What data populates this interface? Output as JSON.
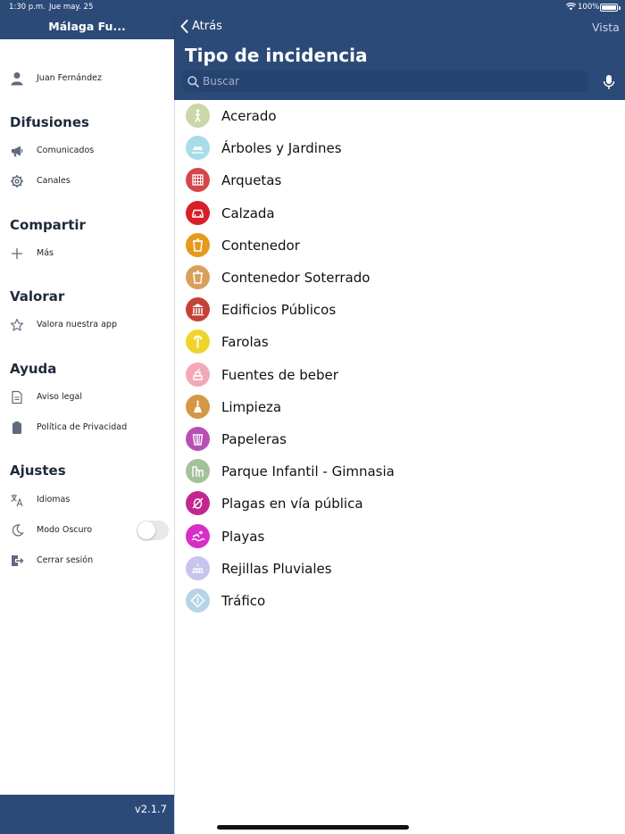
{
  "status": {
    "time": "1:30 p.m.",
    "date": "Jue may. 25",
    "battery": "100%"
  },
  "sidebar": {
    "title": "Málaga Fu...",
    "user": "Juan Fernández",
    "sections": {
      "difusiones": "Difusiones",
      "compartir": "Compartir",
      "valorar": "Valorar",
      "ayuda": "Ayuda",
      "ajustes": "Ajustes"
    },
    "items": {
      "comunicados": "Comunicados",
      "canales": "Canales",
      "mas": "Más",
      "valora": "Valora nuestra app",
      "aviso": "Aviso legal",
      "privacidad": "Política de Privacidad",
      "idiomas": "Idiomas",
      "modo_oscuro": "Modo Oscuro",
      "cerrar": "Cerrar sesión"
    },
    "dark_mode_on": false,
    "version": "v2.1.7"
  },
  "header": {
    "back": "Atrás",
    "vista": "Vista",
    "title": "Tipo de incidencia",
    "search_placeholder": "Buscar"
  },
  "incidencias": [
    {
      "label": "Acerado",
      "color": "#c9d7a9",
      "icon": "pedestrian-icon"
    },
    {
      "label": "Árboles y Jardines",
      "color": "#a9dce9",
      "icon": "tree-icon"
    },
    {
      "label": "Arquetas",
      "color": "#d5464a",
      "icon": "grate-icon"
    },
    {
      "label": "Calzada",
      "color": "#d81f28",
      "icon": "car-icon"
    },
    {
      "label": "Contenedor",
      "color": "#e59a1b",
      "icon": "bin-icon"
    },
    {
      "label": "Contenedor Soterrado",
      "color": "#d9a05c",
      "icon": "bin-icon"
    },
    {
      "label": "Edificios Públicos",
      "color": "#c4423a",
      "icon": "building-icon"
    },
    {
      "label": "Farolas",
      "color": "#efd52b",
      "icon": "lamp-icon"
    },
    {
      "label": "Fuentes de beber",
      "color": "#f1a9b7",
      "icon": "fountain-icon"
    },
    {
      "label": "Limpieza",
      "color": "#d59746",
      "icon": "broom-icon"
    },
    {
      "label": "Papeleras",
      "color": "#b84fb5",
      "icon": "basket-icon"
    },
    {
      "label": "Parque Infantil - Gimnasia",
      "color": "#a3c19a",
      "icon": "playground-icon"
    },
    {
      "label": "Plagas en vía pública",
      "color": "#c3278f",
      "icon": "bug-icon"
    },
    {
      "label": "Playas",
      "color": "#d92dc7",
      "icon": "swim-icon"
    },
    {
      "label": "Rejillas Pluviales",
      "color": "#c8c4ef",
      "icon": "drain-icon"
    },
    {
      "label": "Tráfico",
      "color": "#b6d4e6",
      "icon": "traffic-sign-icon"
    }
  ]
}
